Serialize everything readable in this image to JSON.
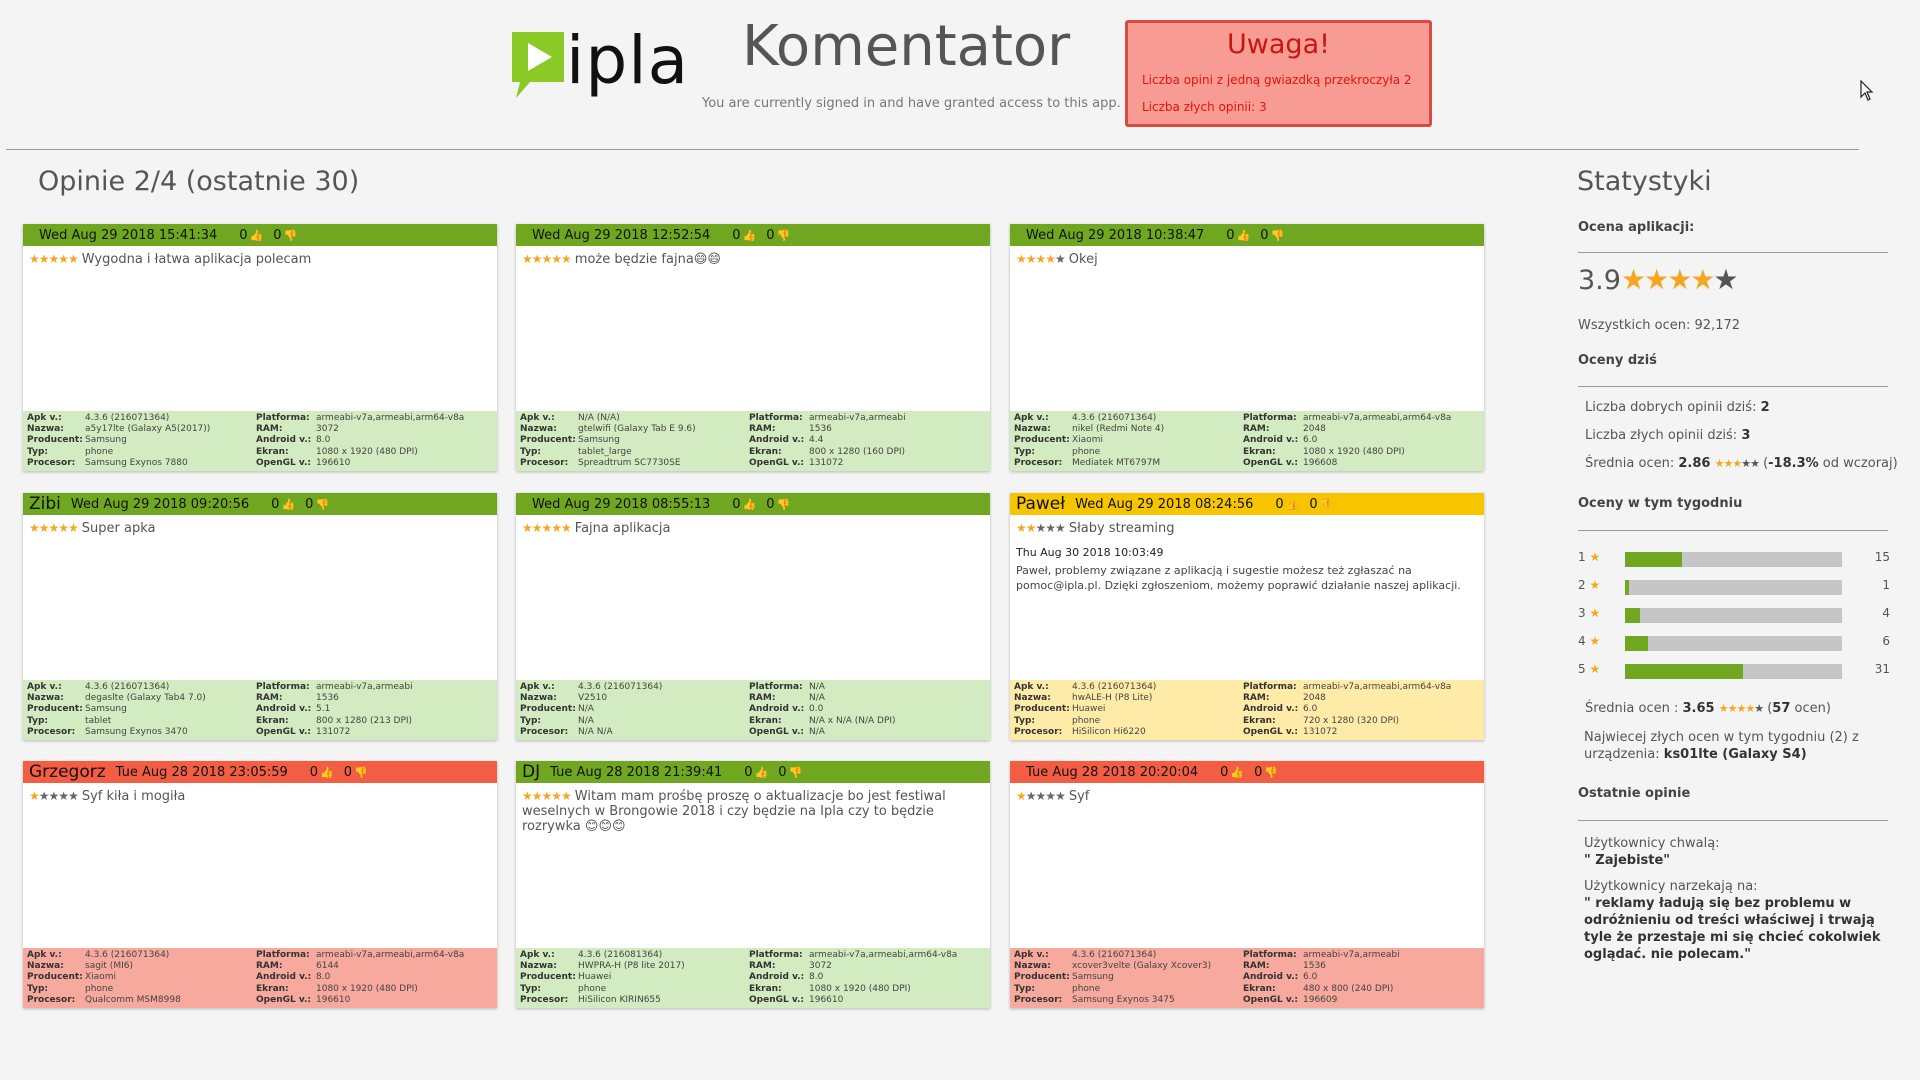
{
  "header": {
    "logo_text": "ipla",
    "app_title": "Komentator",
    "signed_in": "You are currently signed in and have granted access to this app.",
    "alert": {
      "title": "Uwaga!",
      "line1": "Liczba opini z jedną gwiazdką przekroczyła 2",
      "line2": "Liczba złych opinii: 3"
    }
  },
  "reviews": {
    "title": "Opinie 2/4 (ostatnie 30)",
    "labels": {
      "apk": "Apk v.:",
      "name": "Nazwa:",
      "producer": "Producent:",
      "type": "Typ:",
      "cpu": "Procesor:",
      "platform": "Platforma:",
      "ram": "RAM:",
      "android": "Android v.:",
      "screen": "Ekran:",
      "opengl": "OpenGL v.:"
    },
    "cards": [
      {
        "user": "",
        "date": "Wed Aug 29 2018 15:41:34",
        "up": "0",
        "down": "0",
        "rating": 5,
        "text": "Wygodna i łatwa aplikacja polecam",
        "color": "green",
        "apk": "4.3.6 (216071364)",
        "name": "a5y17lte (Galaxy A5(2017))",
        "producer": "Samsung",
        "type": "phone",
        "cpu": "Samsung Exynos 7880",
        "platform": "armeabi-v7a,armeabi,arm64-v8a",
        "ram": "3072",
        "android": "8.0",
        "screen": "1080 x 1920 (480 DPI)",
        "opengl": "196610"
      },
      {
        "user": "",
        "date": "Wed Aug 29 2018 12:52:54",
        "up": "0",
        "down": "0",
        "rating": 5,
        "text": "może będzie fajna😄😄",
        "color": "green",
        "apk": "N/A (N/A)",
        "name": "gtelwifi (Galaxy Tab E 9.6)",
        "producer": "Samsung",
        "type": "tablet_large",
        "cpu": "Spreadtrum SC7730SE",
        "platform": "armeabi-v7a,armeabi",
        "ram": "1536",
        "android": "4.4",
        "screen": "800 x 1280 (160 DPI)",
        "opengl": "131072"
      },
      {
        "user": "",
        "date": "Wed Aug 29 2018 10:38:47",
        "up": "0",
        "down": "0",
        "rating": 4,
        "text": "Okej",
        "color": "green",
        "apk": "4.3.6 (216071364)",
        "name": "nikel (Redmi Note 4)",
        "producer": "Xiaomi",
        "type": "phone",
        "cpu": "Mediatek MT6797M",
        "platform": "armeabi-v7a,armeabi,arm64-v8a",
        "ram": "2048",
        "android": "6.0",
        "screen": "1080 x 1920 (480 DPI)",
        "opengl": "196608"
      },
      {
        "user": "Zibi",
        "date": "Wed Aug 29 2018 09:20:56",
        "up": "0",
        "down": "0",
        "rating": 5,
        "text": "Super apka",
        "color": "green",
        "apk": "4.3.6 (216071364)",
        "name": "degaslte (Galaxy Tab4 7.0)",
        "producer": "Samsung",
        "type": "tablet",
        "cpu": "Samsung Exynos 3470",
        "platform": "armeabi-v7a,armeabi",
        "ram": "1536",
        "android": "5.1",
        "screen": "800 x 1280 (213 DPI)",
        "opengl": "131072"
      },
      {
        "user": "",
        "date": "Wed Aug 29 2018 08:55:13",
        "up": "0",
        "down": "0",
        "rating": 5,
        "text": "Fajna aplikacja",
        "color": "green",
        "apk": "4.3.6 (216071364)",
        "name": "V2510",
        "producer": "N/A",
        "type": "N/A",
        "cpu": "N/A N/A",
        "platform": "N/A",
        "ram": "N/A",
        "android": "0.0",
        "screen": "N/A x N/A (N/A DPI)",
        "opengl": "N/A"
      },
      {
        "user": "Paweł",
        "date": "Wed Aug 29 2018 08:24:56",
        "up": "0",
        "down": "0",
        "rating": 2,
        "text": "Słaby streaming",
        "color": "yellow",
        "reply_date": "Thu Aug 30 2018 10:03:49",
        "reply_text": "Paweł, problemy związane z aplikacją i sugestie możesz też zgłaszać na pomoc@ipla.pl. Dzięki zgłoszeniom, możemy poprawić działanie naszej aplikacji.",
        "apk": "4.3.6 (216071364)",
        "name": "hwALE-H (P8 Lite)",
        "producer": "Huawei",
        "type": "phone",
        "cpu": "HiSilicon Hi6220",
        "platform": "armeabi-v7a,armeabi,arm64-v8a",
        "ram": "2048",
        "android": "6.0",
        "screen": "720 x 1280 (320 DPI)",
        "opengl": "131072"
      },
      {
        "user": "Grzegorz",
        "date": "Tue Aug 28 2018 23:05:59",
        "up": "0",
        "down": "0",
        "rating": 1,
        "text": "Syf kiła i mogiła",
        "color": "red",
        "apk": "4.3.6 (216071364)",
        "name": "sagit (MI6)",
        "producer": "Xiaomi",
        "type": "phone",
        "cpu": "Qualcomm MSM8998",
        "platform": "armeabi-v7a,armeabi,arm64-v8a",
        "ram": "6144",
        "android": "8.0",
        "screen": "1080 x 1920 (480 DPI)",
        "opengl": "196610"
      },
      {
        "user": "DJ",
        "date": "Tue Aug 28 2018 21:39:41",
        "up": "0",
        "down": "0",
        "rating": 5,
        "text": "Witam mam prośbę proszę o aktualizacje bo jest festiwal weselnych w Brongowie 2018 i czy będzie na Ipla czy to będzie rozrywka 😊😊😊",
        "color": "green",
        "apk": "4.3.6 (216081364)",
        "name": "HWPRA-H (P8 lite 2017)",
        "producer": "Huawei",
        "type": "phone",
        "cpu": "HiSilicon KIRIN655",
        "platform": "armeabi-v7a,armeabi,arm64-v8a",
        "ram": "3072",
        "android": "8.0",
        "screen": "1080 x 1920 (480 DPI)",
        "opengl": "196610"
      },
      {
        "user": "",
        "date": "Tue Aug 28 2018 20:20:04",
        "up": "0",
        "down": "0",
        "rating": 1,
        "text": "Syf",
        "color": "red",
        "apk": "4.3.6 (216071364)",
        "name": "xcover3velte (Galaxy Xcover3)",
        "producer": "Samsung",
        "type": "phone",
        "cpu": "Samsung Exynos 3475",
        "platform": "armeabi-v7a,armeabi",
        "ram": "1536",
        "android": "6.0",
        "screen": "480 x 800 (240 DPI)",
        "opengl": "196609"
      }
    ]
  },
  "stats": {
    "title": "Statystyki",
    "app_rating_label": "Ocena aplikacji:",
    "rating": "3.9",
    "rating_value": 3.9,
    "total_label": "Wszystkich ocen: 92,172",
    "today_label": "Oceny dziś",
    "good_today_label": "Liczba dobrych opinii dziś:",
    "good_today": "2",
    "bad_today_label": "Liczba złych opinii dziś:",
    "bad_today": "3",
    "avg_today_label": "Średnia ocen:",
    "avg_today": "2.86",
    "avg_today_change": "-18.3%",
    "avg_today_suffix": "od wczoraj",
    "week_label": "Oceny w tym tygodniu",
    "week_bars": [
      {
        "stars": "1",
        "count": 15
      },
      {
        "stars": "2",
        "count": 1
      },
      {
        "stars": "3",
        "count": 4
      },
      {
        "stars": "4",
        "count": 6
      },
      {
        "stars": "5",
        "count": 31
      }
    ],
    "week_avg_label": "Średnia ocen :",
    "week_avg": "3.65",
    "week_avg_count": "57",
    "week_avg_suffix": "ocen",
    "worst_device_prefix": "Najwiecej złych ocen w tym tygodniu (2) z urządzenia:",
    "worst_device": "ks01lte (Galaxy S4)",
    "recent_label": "Ostatnie opinie",
    "praise_label": "Użytkownicy chwalą:",
    "praise": "\" Zajebiste\"",
    "complain_label": "Użytkownicy narzekają na:",
    "complain": "\" reklamy ładują się bez problemu w odróżnieniu od treści właściwej i trwają tyle że przestaje mi się chcieć cokolwiek oglądać. nie polecam.\""
  },
  "colors": {
    "green_header": "#6fa820",
    "yellow_header": "#f7c500",
    "red_header": "#f25d43",
    "star": "#f6a623"
  },
  "icons": {
    "thumb_up": "thumb-up-icon",
    "thumb_down": "thumb-down-icon",
    "star": "star-icon"
  }
}
